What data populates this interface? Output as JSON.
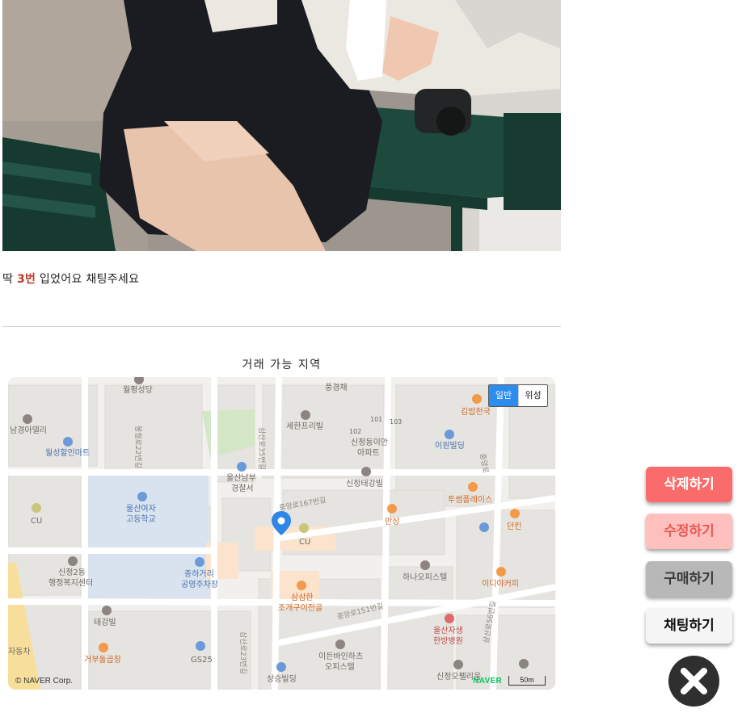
{
  "post": {
    "caption_prefix": "딱 ",
    "caption_highlight": "3번",
    "caption_suffix": " 입었어요 채팅주세요",
    "accent_color": "#c0392b"
  },
  "location": {
    "title": "거래 가능 지역"
  },
  "map": {
    "mode_options": [
      "일반",
      "위성"
    ],
    "selected_mode": "일반",
    "copyright": "© NAVER Corp.",
    "brand": "NAVER",
    "scale": "50m",
    "places": [
      "월평성당",
      "풍경채",
      "남경아델리",
      "월성할인마트",
      "세한프리빌",
      "101",
      "102",
      "103",
      "신정동이안",
      "아파트",
      "이원빌딩",
      "김밥천국",
      "울산남부",
      "경찰서",
      "신정태강빌",
      "울산여자",
      "고등학교",
      "CU",
      "투썸플레이스",
      "만상",
      "던킨",
      "신정2동",
      "행정복지센터",
      "종하거리",
      "공영주차장",
      "하나오피스텔",
      "이디야커피",
      "삼삼한",
      "조개구이전골",
      "태강빌",
      "울산자생",
      "한방병원",
      "거부돌곱창",
      "GS25",
      "이든바인하츠",
      "오피스텔",
      "상승빌딩",
      "신정오펠리움",
      "자동차"
    ],
    "roads": [
      "삼산로35번길",
      "봉월로22번길",
      "중앙로167번길",
      "중앙로151번길",
      "삼산로23번길",
      "삼산로56번길",
      "중앙로"
    ]
  },
  "actions": {
    "delete": "삭제하기",
    "edit": "수정하기",
    "buy": "구매하기",
    "chat": "채팅하기"
  },
  "colors": {
    "delete_bg": "#fa6c6b",
    "edit_bg": "#ffc0bd",
    "buy_bg": "#b8b8b8",
    "chat_bg": "#f5f5f5",
    "close_bg": "#2f2f2f",
    "map_active": "#2d8cf0"
  }
}
